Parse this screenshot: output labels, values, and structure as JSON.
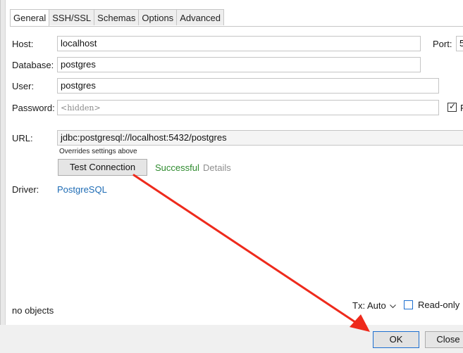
{
  "tabs": [
    "General",
    "SSH/SSL",
    "Schemas",
    "Options",
    "Advanced"
  ],
  "form": {
    "host_label": "Host:",
    "host_value": "localhost",
    "port_label": "Port:",
    "port_value": "5",
    "database_label": "Database:",
    "database_value": "postgres",
    "user_label": "User:",
    "user_value": "postgres",
    "password_label": "Password:",
    "password_placeholder": "<hidden>",
    "remember_partial": "R",
    "url_label": "URL:",
    "url_value": "jdbc:postgresql://localhost:5432/postgres",
    "url_hint": "Overrides settings above",
    "test_button": "Test Connection",
    "test_status": "Successful",
    "details_link": "Details",
    "driver_label": "Driver:",
    "driver_value": "PostgreSQL"
  },
  "footer": {
    "objects_text": "no objects",
    "tx_label": "Tx: Auto",
    "readonly_label": "Read-only",
    "ok_button": "OK",
    "close_button": "Close"
  },
  "colors": {
    "success": "#2e8b2e",
    "link": "#1e6cb5",
    "annotation_arrow": "#ee2a1c"
  },
  "icons": {
    "tx_dropdown": "chevron-down-icon",
    "annotation": "red-arrow-icon"
  }
}
